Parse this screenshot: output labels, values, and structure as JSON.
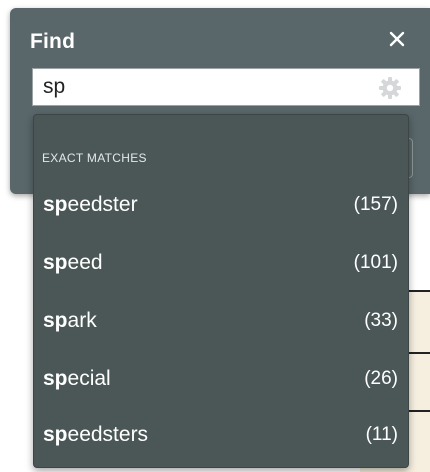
{
  "find_panel": {
    "title": "Find",
    "close_icon": "close-icon",
    "settings_icon": "gear-icon",
    "search": {
      "value": "sp",
      "placeholder": ""
    }
  },
  "suggestions": {
    "header": "EXACT MATCHES",
    "items": [
      {
        "match": "sp",
        "rest": "eedster",
        "count": "(157)"
      },
      {
        "match": "sp",
        "rest": "eed",
        "count": "(101)"
      },
      {
        "match": "sp",
        "rest": "ark",
        "count": "(33)"
      },
      {
        "match": "sp",
        "rest": "ecial",
        "count": "(26)"
      },
      {
        "match": "sp",
        "rest": "eedsters",
        "count": "(11)"
      }
    ]
  },
  "colors": {
    "panel": "#59676a",
    "dropdown": "#4b5757",
    "text": "#ffffff"
  }
}
